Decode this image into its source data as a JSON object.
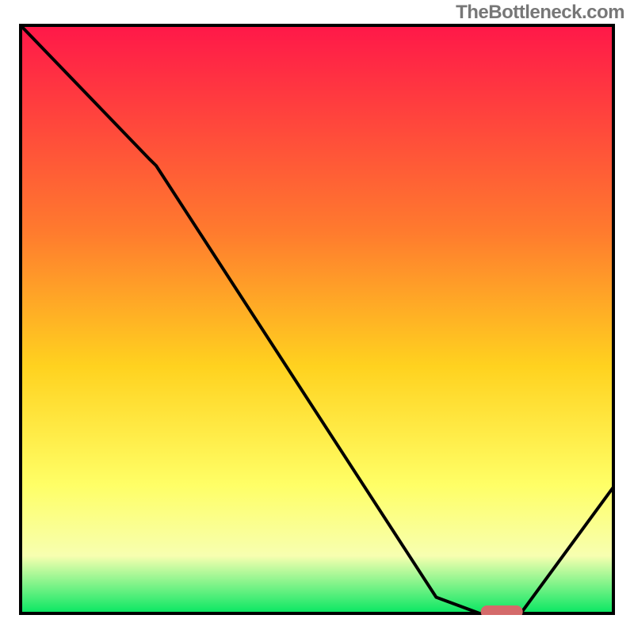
{
  "watermark": "TheBottleneck.com",
  "colors": {
    "top": "#ff1749",
    "mid1": "#ff7a2e",
    "mid2": "#ffd21f",
    "mid3": "#ffff66",
    "mid4": "#f7ffb0",
    "bottom": "#00e660",
    "border": "#000000",
    "curve": "#000000",
    "marker": "#d46a6a"
  },
  "chart_data": {
    "type": "line",
    "title": "",
    "xlabel": "",
    "ylabel": "",
    "xlim": [
      0,
      100
    ],
    "ylim": [
      0,
      100
    ],
    "series": [
      {
        "name": "bottleneck-curve",
        "x": [
          0,
          22,
          23,
          70,
          78,
          84,
          100
        ],
        "y": [
          100,
          77,
          76,
          3,
          0,
          0,
          22
        ]
      }
    ],
    "marker": {
      "name": "optimal-range",
      "x_start": 78,
      "x_end": 84,
      "y": 0
    },
    "gradient_stops": [
      {
        "pct": 0,
        "color": "#ff1749"
      },
      {
        "pct": 35,
        "color": "#ff7a2e"
      },
      {
        "pct": 58,
        "color": "#ffd21f"
      },
      {
        "pct": 78,
        "color": "#ffff66"
      },
      {
        "pct": 90,
        "color": "#f7ffb0"
      },
      {
        "pct": 100,
        "color": "#00e660"
      }
    ]
  }
}
